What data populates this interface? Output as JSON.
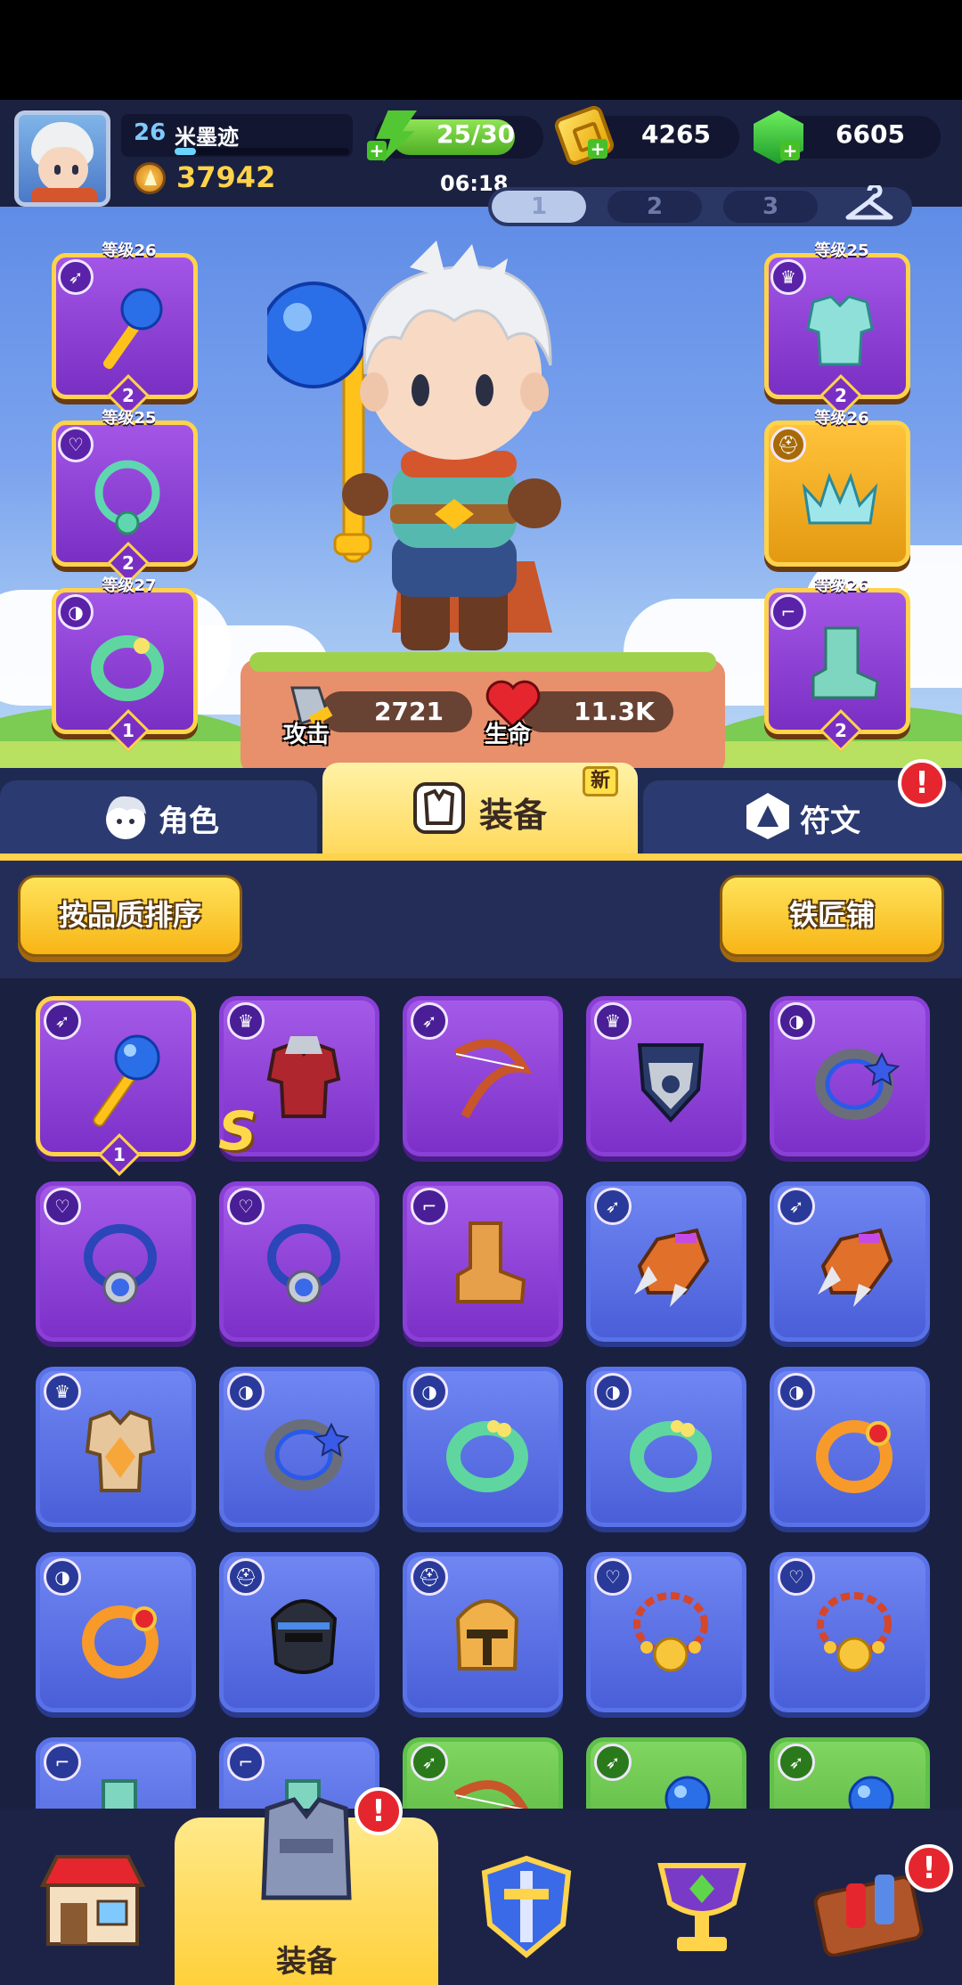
{
  "player": {
    "level": "26",
    "name": "米墨迹",
    "xp_fraction": 0.12,
    "power": "37942"
  },
  "resources": {
    "energy": "25/30",
    "energy_fraction": 0.83,
    "energy_timer": "06:18",
    "gold": "4265",
    "gems": "6605"
  },
  "loadouts": [
    "1",
    "2",
    "3"
  ],
  "active_loadout": 0,
  "equipped_slots": {
    "left": [
      {
        "level_label": "等级26",
        "item": "blue-orb-staff",
        "badge": "2",
        "type_icon": "bow-type-icon"
      },
      {
        "level_label": "等级25",
        "item": "jade-necklace",
        "badge": "2",
        "type_icon": "necklace-type-icon"
      },
      {
        "level_label": "等级27",
        "item": "green-ring",
        "badge": "1",
        "type_icon": "ring-type-icon"
      }
    ],
    "right": [
      {
        "level_label": "等级25",
        "item": "teal-armor",
        "badge": "2",
        "type_icon": "armor-type-icon"
      },
      {
        "level_label": "等级26",
        "item": "crystal-crown",
        "badge": "",
        "type_icon": "helmet-type-icon"
      },
      {
        "level_label": "等级26",
        "item": "teal-boots",
        "badge": "2",
        "type_icon": "boots-type-icon"
      }
    ]
  },
  "stats": {
    "attack_label": "攻击",
    "attack_value": "2721",
    "hp_label": "生命",
    "hp_value": "11.3K"
  },
  "tabs": {
    "character": "角色",
    "equipment": "装备",
    "new_badge": "新",
    "runes": "符文",
    "runes_alert": "!"
  },
  "buttons": {
    "sort": "按品质排序",
    "blacksmith": "铁匠铺"
  },
  "inventory": [
    {
      "rarity": "purple",
      "item": "blue-orb-staff",
      "type_icon": "bow-type-icon",
      "equipped": true,
      "badge": "1"
    },
    {
      "rarity": "purple",
      "item": "crimson-armor",
      "type_icon": "armor-type-icon",
      "star": "S"
    },
    {
      "rarity": "purple",
      "item": "recurve-bow",
      "type_icon": "bow-type-icon"
    },
    {
      "rarity": "purple",
      "item": "shield-armor",
      "type_icon": "armor-type-icon"
    },
    {
      "rarity": "purple",
      "item": "steel-ring",
      "type_icon": "ring-type-icon"
    },
    {
      "rarity": "purple",
      "item": "sapphire-necklace",
      "type_icon": "necklace-type-icon"
    },
    {
      "rarity": "purple",
      "item": "sapphire-necklace",
      "type_icon": "necklace-type-icon"
    },
    {
      "rarity": "purple",
      "item": "leather-boots",
      "type_icon": "boots-type-icon"
    },
    {
      "rarity": "blue",
      "item": "claw-gauntlet",
      "type_icon": "bow-type-icon"
    },
    {
      "rarity": "blue",
      "item": "claw-gauntlet",
      "type_icon": "bow-type-icon"
    },
    {
      "rarity": "blue",
      "item": "gold-vest",
      "type_icon": "armor-type-icon"
    },
    {
      "rarity": "blue",
      "item": "steel-ring",
      "type_icon": "ring-type-icon"
    },
    {
      "rarity": "blue",
      "item": "green-ring",
      "type_icon": "ring-type-icon"
    },
    {
      "rarity": "blue",
      "item": "green-ring",
      "type_icon": "ring-type-icon"
    },
    {
      "rarity": "blue",
      "item": "orange-ring",
      "type_icon": "ring-type-icon"
    },
    {
      "rarity": "blue",
      "item": "orange-ring",
      "type_icon": "ring-type-icon"
    },
    {
      "rarity": "blue",
      "item": "mask-helmet",
      "type_icon": "helmet-type-icon"
    },
    {
      "rarity": "blue",
      "item": "knight-helmet",
      "type_icon": "helmet-type-icon"
    },
    {
      "rarity": "blue",
      "item": "chain-necklace",
      "type_icon": "necklace-type-icon"
    },
    {
      "rarity": "blue",
      "item": "chain-necklace",
      "type_icon": "necklace-type-icon"
    },
    {
      "rarity": "blue",
      "item": "teal-boots",
      "type_icon": "boots-type-icon"
    },
    {
      "rarity": "blue",
      "item": "teal-boots",
      "type_icon": "boots-type-icon"
    },
    {
      "rarity": "green",
      "item": "recurve-bow",
      "type_icon": "bow-type-icon"
    },
    {
      "rarity": "green",
      "item": "blue-orb-staff",
      "type_icon": "bow-type-icon"
    },
    {
      "rarity": "green",
      "item": "blue-orb-staff",
      "type_icon": "bow-type-icon"
    }
  ],
  "bottom_nav": [
    {
      "name": "shop-icon"
    },
    {
      "name": "equipment-icon",
      "label": "装备",
      "alert": "!"
    },
    {
      "name": "battle-shield-icon"
    },
    {
      "name": "trophy-icon"
    },
    {
      "name": "hammer-workshop-icon",
      "alert": "!"
    }
  ],
  "colors": {
    "purple_rarity": "#8a3fd6",
    "blue_rarity": "#5a72e8",
    "green_rarity": "#5fc04a",
    "accent_yellow": "#ffd34a",
    "alert_red": "#e6262e"
  }
}
